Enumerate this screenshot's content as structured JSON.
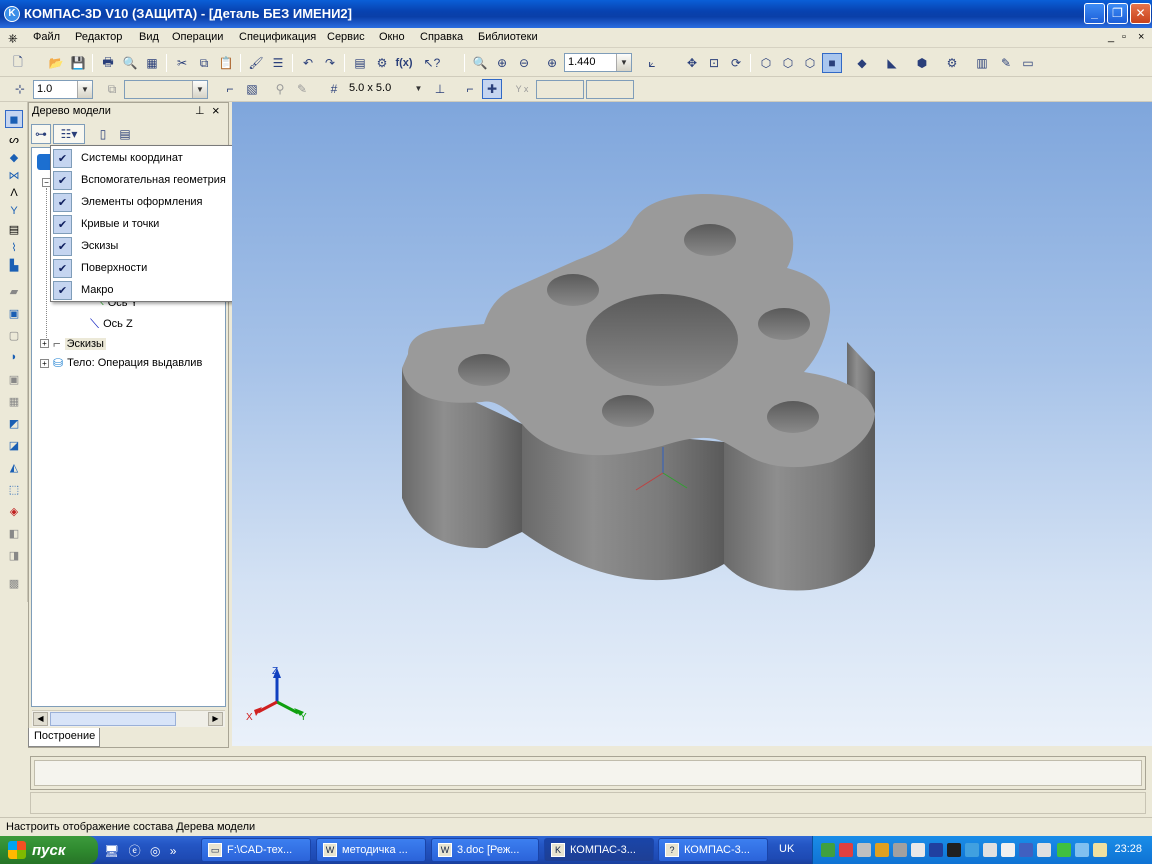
{
  "window": {
    "title": "КОМПАС-3D V10 (ЗАЩИТА) - [Деталь БЕЗ ИМЕНИ2]",
    "app_icon": "kompas-icon"
  },
  "menu": {
    "items": [
      "Файл",
      "Редактор",
      "Вид",
      "Операции",
      "Спецификация",
      "Сервис",
      "Окно",
      "Справка",
      "Библиотеки"
    ],
    "mdi_controls": [
      "_",
      "▫",
      "×"
    ]
  },
  "toolbar": {
    "scale_value": "1.440",
    "fx_label": "f(x)"
  },
  "toolbar2": {
    "step_value": "1.0",
    "grid_value": "5.0 x 5.0",
    "xy_label": "Y x"
  },
  "tree": {
    "title": "Дерево модели",
    "pin": "ᵠ",
    "close": "×",
    "nodes": [
      {
        "label": "Ось Y"
      },
      {
        "label": "Ось Z"
      },
      {
        "label": "Эскизы"
      },
      {
        "label": "Тело:  Операция выдавлив"
      }
    ],
    "tab": "Построение"
  },
  "popup": {
    "items": [
      {
        "label": "Системы координат",
        "checked": true
      },
      {
        "label": "Вспомогательная геометрия",
        "checked": true
      },
      {
        "label": "Элементы оформления",
        "checked": true
      },
      {
        "label": "Кривые и точки",
        "checked": true
      },
      {
        "label": "Эскизы",
        "checked": true
      },
      {
        "label": "Поверхности",
        "checked": true
      },
      {
        "label": "Макро",
        "checked": true
      }
    ]
  },
  "triad": {
    "z": "Z",
    "x": "X",
    "y": "Y"
  },
  "status": {
    "text": "Настроить отображение состава Дерева модели"
  },
  "taskbar": {
    "start": "пуск",
    "tasks": [
      {
        "label": "F:\\CAD-тех...",
        "icon": "folder-icon"
      },
      {
        "label": "методичка ...",
        "icon": "word-icon"
      },
      {
        "label": "3.doc [Реж...",
        "icon": "word-icon"
      },
      {
        "label": "КОМПАС-3...",
        "icon": "kompas-icon"
      },
      {
        "label": "КОМПАС-3...",
        "icon": "help-icon"
      }
    ],
    "lang": "UK",
    "clock": "23:28"
  }
}
